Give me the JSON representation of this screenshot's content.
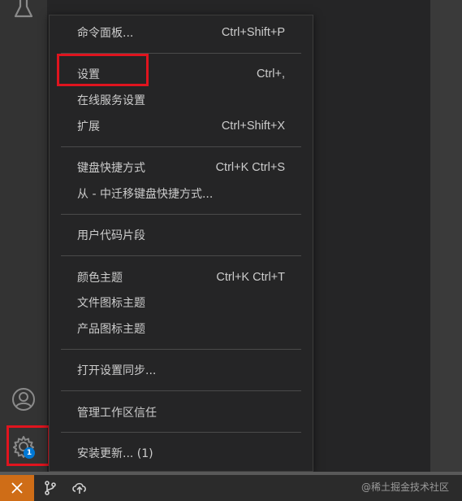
{
  "colors": {
    "highlight": "#e0141e",
    "menu_bg": "#252526",
    "menu_text": "#cccccc",
    "badge": "#0078d4",
    "remote_button": "#cf6d17"
  },
  "activity_bar": {
    "icons": [
      "flask-icon",
      "account-icon",
      "gear-icon"
    ],
    "gear_badge": "1"
  },
  "menu": {
    "items": [
      {
        "label": "命令面板...",
        "shortcut": "Ctrl+Shift+P"
      },
      {
        "label": "设置",
        "shortcut": "Ctrl+,"
      },
      {
        "label": "在线服务设置",
        "shortcut": ""
      },
      {
        "label": "扩展",
        "shortcut": "Ctrl+Shift+X"
      },
      {
        "label": "键盘快捷方式",
        "shortcut": "Ctrl+K Ctrl+S"
      },
      {
        "label": "从 - 中迁移键盘快捷方式...",
        "shortcut": ""
      },
      {
        "label": "用户代码片段",
        "shortcut": ""
      },
      {
        "label": "颜色主题",
        "shortcut": "Ctrl+K Ctrl+T"
      },
      {
        "label": "文件图标主题",
        "shortcut": ""
      },
      {
        "label": "产品图标主题",
        "shortcut": ""
      },
      {
        "label": "打开设置同步...",
        "shortcut": ""
      },
      {
        "label": "管理工作区信任",
        "shortcut": ""
      },
      {
        "label": "安装更新... (1)",
        "shortcut": ""
      }
    ]
  },
  "status_bar": {
    "icons": [
      "remote-icon",
      "source-control-icon",
      "cloud-upload-icon"
    ],
    "watermark": "@稀土掘金技术社区"
  }
}
